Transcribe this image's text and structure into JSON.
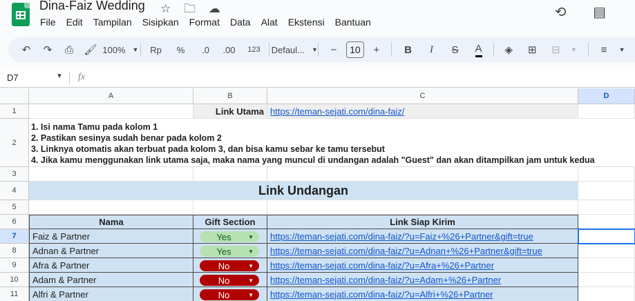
{
  "app": {
    "title": "Dina-Faiz Wedding",
    "menu": [
      "File",
      "Edit",
      "Tampilan",
      "Sisipkan",
      "Format",
      "Data",
      "Alat",
      "Ekstensi",
      "Bantuan"
    ]
  },
  "toolbar": {
    "zoom": "100%",
    "currency": "Rp",
    "percent": "%",
    "dec_decrease": ".0",
    "dec_increase": ".00",
    "number_format": "123",
    "font": "Defaul...",
    "font_size": "10",
    "minus": "−",
    "plus": "+",
    "bold": "B",
    "italic": "I",
    "strike": "S",
    "text_color": "A"
  },
  "formula_bar": {
    "cell_ref": "D7",
    "fx": "fx"
  },
  "sheet": {
    "columns": [
      "A",
      "B",
      "C",
      "D"
    ],
    "rows": [
      "1",
      "2",
      "3",
      "4",
      "5",
      "6",
      "7",
      "8",
      "9",
      "10",
      "11"
    ],
    "row1": {
      "label": "Link Utama",
      "url": "https://teman-sejati.com/dina-faiz/"
    },
    "instructions": [
      "1. Isi nama Tamu pada kolom 1",
      "2. Pastikan sesinya sudah benar pada kolom 2",
      "3. Linknya otomatis akan terbuat pada kolom 3, dan bisa kamu sebar ke tamu tersebut",
      "4. Jika kamu menggunakan link utama saja, maka nama yang muncul di undangan adalah \"Guest\" dan akan ditampilkan jam untuk kedua"
    ],
    "section_title": "Link Undangan",
    "headers": [
      "Nama",
      "Gift Section",
      "Link Siap Kirim"
    ],
    "guests": [
      {
        "name": "Faiz & Partner",
        "gift": "Yes",
        "link": "https://teman-sejati.com/dina-faiz/?u=Faiz+%26+Partner&gift=true"
      },
      {
        "name": "Adnan & Partner",
        "gift": "Yes",
        "link": "https://teman-sejati.com/dina-faiz/?u=Adnan+%26+Partner&gift=true"
      },
      {
        "name": "Afra & Partner",
        "gift": "No",
        "link": "https://teman-sejati.com/dina-faiz/?u=Afra+%26+Partner"
      },
      {
        "name": "Adam & Partner",
        "gift": "No",
        "link": "https://teman-sejati.com/dina-faiz/?u=Adam+%26+Partner"
      },
      {
        "name": "Alfri & Partner",
        "gift": "No",
        "link": "https://teman-sejati.com/dina-faiz/?u=Alfri+%26+Partner"
      }
    ]
  },
  "colors": {
    "yes_chip": "#b7e1b0",
    "no_chip": "#b10202",
    "header_blue": "#cfe2f3",
    "selection": "#1a73e8"
  }
}
